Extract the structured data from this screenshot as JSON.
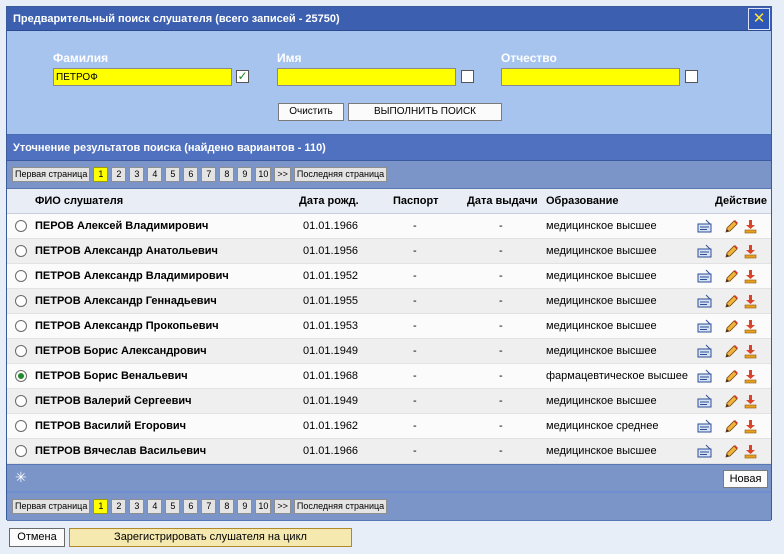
{
  "window": {
    "title": "Предварительный поиск слушателя (всего записей - 25750)",
    "close_label": "✕"
  },
  "search": {
    "surname_label": "Фамилия",
    "surname_value": "ПЕТРОФ",
    "surname_checked": "✓",
    "name_label": "Имя",
    "name_value": "",
    "patronymic_label": "Отчество",
    "patronymic_value": "",
    "clear_label": "Очистить",
    "search_label": "ВЫПОЛНИТЬ ПОИСК"
  },
  "results": {
    "title": "Уточнение результатов поиска (найдено вариантов - 110)"
  },
  "pager": {
    "first_label": "Первая страница",
    "last_label": "Последняя страница",
    "next_label": ">>",
    "pages": [
      "1",
      "2",
      "3",
      "4",
      "5",
      "6",
      "7",
      "8",
      "9",
      "10"
    ],
    "current": "1"
  },
  "table": {
    "headers": {
      "name": "ФИО слушателя",
      "dob": "Дата рожд.",
      "passport": "Паспорт",
      "issue": "Дата выдачи",
      "education": "Образование",
      "action": "Действие"
    },
    "rows": [
      {
        "name": "ПЕРОВ Алексей Владимирович",
        "dob": "01.01.1966",
        "passport": "-",
        "issue": "-",
        "education": "медицинское высшее"
      },
      {
        "name": "ПЕТРОВ Александр Анатольевич",
        "dob": "01.01.1956",
        "passport": "-",
        "issue": "-",
        "education": "медицинское высшее"
      },
      {
        "name": "ПЕТРОВ Александр Владимирович",
        "dob": "01.01.1952",
        "passport": "-",
        "issue": "-",
        "education": "медицинское высшее"
      },
      {
        "name": "ПЕТРОВ Александр Геннадьевич",
        "dob": "01.01.1955",
        "passport": "-",
        "issue": "-",
        "education": "медицинское высшее"
      },
      {
        "name": "ПЕТРОВ Александр Прокопьевич",
        "dob": "01.01.1953",
        "passport": "-",
        "issue": "-",
        "education": "медицинское высшее"
      },
      {
        "name": "ПЕТРОВ Борис Александрович",
        "dob": "01.01.1949",
        "passport": "-",
        "issue": "-",
        "education": "медицинское высшее"
      },
      {
        "name": "ПЕТРОВ Борис Венальевич",
        "dob": "01.01.1968",
        "passport": "-",
        "issue": "-",
        "education": "фармацевтическое высшее"
      },
      {
        "name": "ПЕТРОВ Валерий Сергеевич",
        "dob": "01.01.1949",
        "passport": "-",
        "issue": "-",
        "education": "медицинское высшее"
      },
      {
        "name": "ПЕТРОВ Василий Егорович",
        "dob": "01.01.1962",
        "passport": "-",
        "issue": "-",
        "education": "медицинское среднее"
      },
      {
        "name": "ПЕТРОВ Вячеслав Васильевич",
        "dob": "01.01.1966",
        "passport": "-",
        "issue": "-",
        "education": "медицинское высшее"
      }
    ],
    "selected_index": 6
  },
  "footer": {
    "add_icon": "✳",
    "new_label": "Новая"
  },
  "actions": {
    "cancel_label": "Отмена",
    "register_label": "Зарегистрировать слушателя на цикл"
  },
  "colors": {
    "title_bar": "#3c5fb0",
    "search_panel": "#a7c4ee",
    "input_highlight": "#ffff00",
    "pager_bar": "#7c95c9",
    "close_glyph": "#ffe23a"
  }
}
